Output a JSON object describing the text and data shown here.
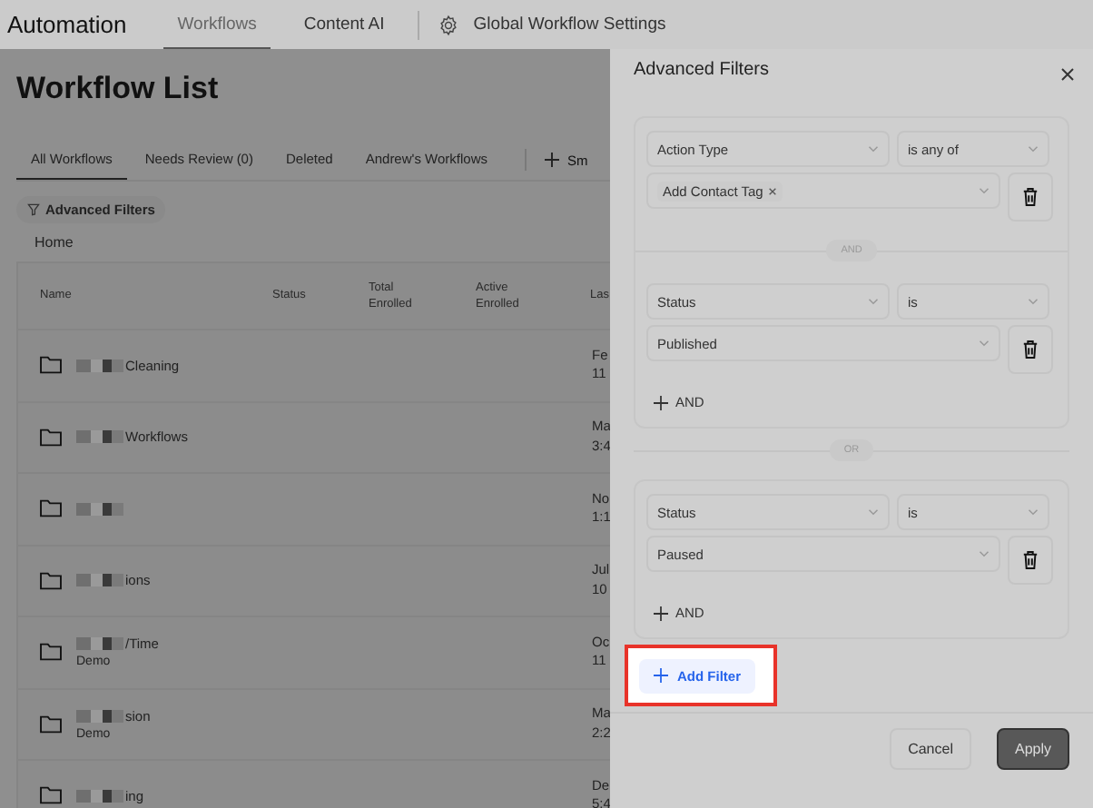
{
  "top_nav": {
    "brand": "Automation",
    "tabs": [
      {
        "label": "Workflows",
        "selected": true
      },
      {
        "label": "Content AI",
        "selected": false
      }
    ],
    "settings_link": "Global Workflow Settings"
  },
  "page": {
    "title": "Workflow List",
    "tabs": [
      {
        "label": "All Workflows",
        "selected": true
      },
      {
        "label": "Needs Review (0)",
        "selected": false
      },
      {
        "label": "Deleted",
        "selected": false
      },
      {
        "label": "Andrew's Workflows",
        "selected": false
      }
    ],
    "add_view_label": "Sm",
    "filter_button": "Advanced Filters",
    "breadcrumb": "Home",
    "table": {
      "columns": [
        "Name",
        "Status",
        "Total Enrolled",
        "Active Enrolled",
        "Las"
      ],
      "rows": [
        {
          "name": "Cleaning",
          "updated": [
            "Fe",
            "11"
          ]
        },
        {
          "name": "Workflows",
          "updated": [
            "Ma",
            "3:4"
          ]
        },
        {
          "updated": [
            "No",
            "1:1"
          ]
        },
        {
          "name": "ions",
          "updated": [
            "Jul",
            "10"
          ]
        },
        {
          "name": "/Time",
          "subtitle": "Demo",
          "updated": [
            "Oc",
            "11"
          ]
        },
        {
          "name": "sion",
          "subtitle": "Demo",
          "updated": [
            "Ma",
            "2:2"
          ]
        },
        {
          "name": "ing",
          "updated": [
            "De",
            "5:4"
          ]
        }
      ]
    }
  },
  "drawer": {
    "title": "Advanced Filters",
    "groups": [
      {
        "conditions": [
          {
            "field": "Action Type",
            "operator": "is any of",
            "tags": [
              "Add Contact Tag"
            ]
          },
          {
            "field": "Status",
            "operator": "is",
            "value": "Published"
          }
        ],
        "joiner": "AND",
        "add_label": "AND"
      },
      {
        "conditions": [
          {
            "field": "Status",
            "operator": "is",
            "value": "Paused"
          }
        ],
        "add_label": "AND"
      }
    ],
    "group_joiner": "OR",
    "add_filter": "Add Filter",
    "buttons": [
      {
        "label": "Cancel",
        "kind": "secondary"
      },
      {
        "label": "Apply",
        "kind": "primary"
      }
    ]
  }
}
